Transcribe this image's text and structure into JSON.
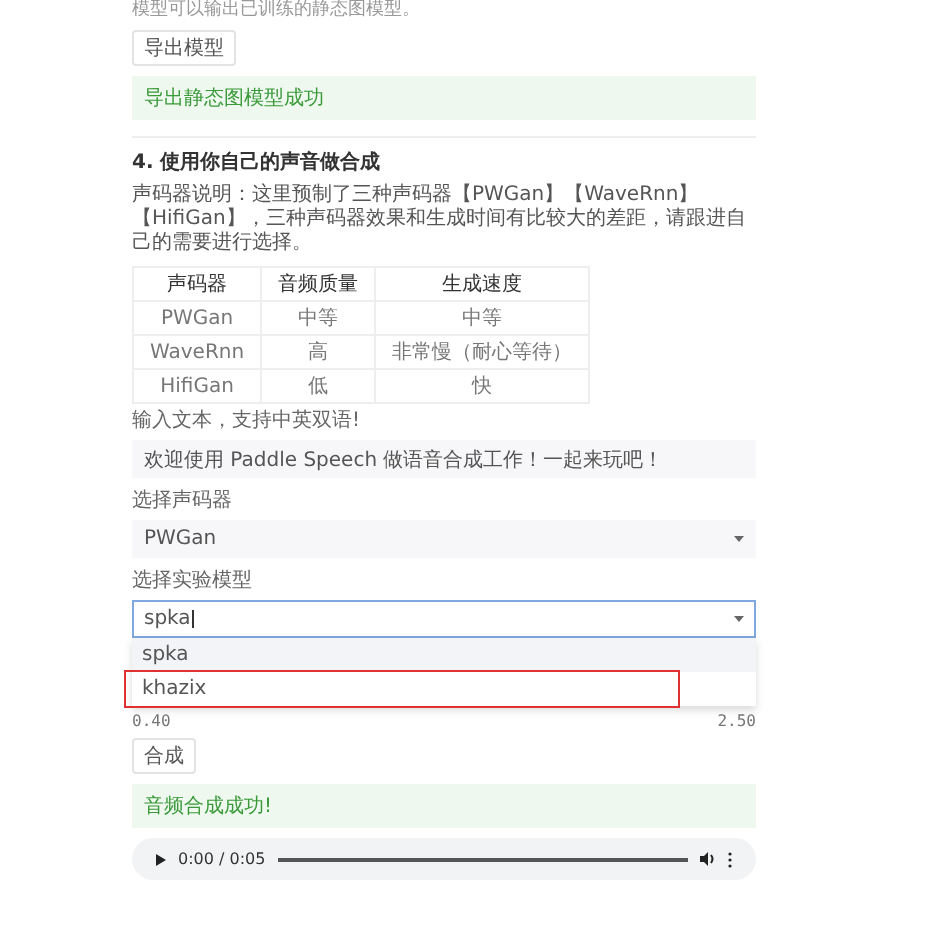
{
  "intro": "模型可以输出已训练的静态图模型。",
  "export_button": "导出模型",
  "export_alert": "导出静态图模型成功",
  "section_title": "4. 使用你自己的声音做合成",
  "description": "声码器说明：这里预制了三种声码器【PWGan】【WaveRnn】【HifiGan】，三种声码器效果和生成时间有比较大的差距，请跟进自己的需要进行选择。",
  "table": {
    "columns": [
      "声码器",
      "音频质量",
      "生成速度"
    ],
    "rows": [
      [
        "PWGan",
        "中等",
        "中等"
      ],
      [
        "WaveRnn",
        "高",
        "非常慢（耐心等待）"
      ],
      [
        "HifiGan",
        "低",
        "快"
      ]
    ]
  },
  "text_input": {
    "label": "输入文本，支持中英双语!",
    "value": "欢迎使用 Paddle Speech 做语音合成工作！一起来玩吧！"
  },
  "vocoder_select": {
    "label": "选择声码器",
    "value": "PWGan"
  },
  "model_select": {
    "label": "选择实验模型",
    "value": "spka",
    "options": [
      {
        "label": "spka",
        "hovered": true,
        "annotated": false
      },
      {
        "label": "khazix",
        "hovered": false,
        "annotated": true
      }
    ]
  },
  "slider": {
    "min": "0.40",
    "max": "2.50"
  },
  "synth_button": "合成",
  "synth_alert": "音频合成成功!",
  "audio": {
    "time": "0:00 / 0:05"
  }
}
